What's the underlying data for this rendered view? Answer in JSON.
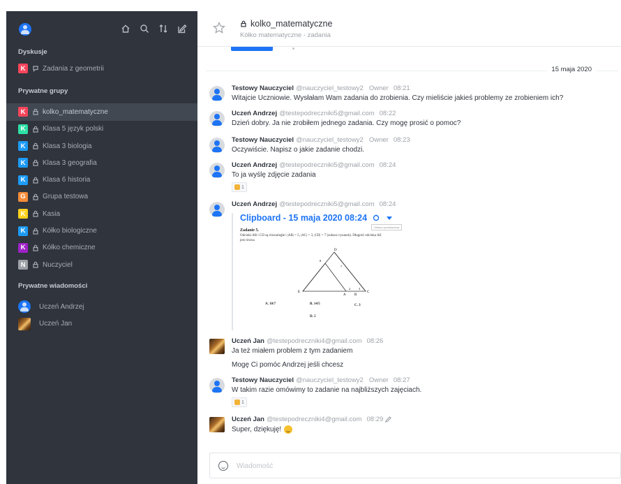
{
  "sidebar": {
    "sections": {
      "discussions": "Dyskusje",
      "private_groups": "Prywatne grupy",
      "private_messages": "Prywatne wiadomości"
    },
    "discussions": [
      {
        "badge": "K",
        "color": "#f5455c",
        "label": "Zadania z geometrii"
      }
    ],
    "groups": [
      {
        "badge": "K",
        "color": "#f5455c",
        "label": "kolko_matematyczne",
        "active": true
      },
      {
        "badge": "K",
        "color": "#2de0a5",
        "label": "Klasa 5 język polski"
      },
      {
        "badge": "K",
        "color": "#1d9bf5",
        "label": "Klasa 3 biologia"
      },
      {
        "badge": "K",
        "color": "#1d9bf5",
        "label": "Klasa 3 geografia"
      },
      {
        "badge": "K",
        "color": "#1d9bf5",
        "label": "Klasa 6 historia"
      },
      {
        "badge": "G",
        "color": "#f38c39",
        "label": "Grupa testowa"
      },
      {
        "badge": "K",
        "color": "#ffd21f",
        "label": "Kasia"
      },
      {
        "badge": "K",
        "color": "#1d9bf5",
        "label": "Kółko biologiczne"
      },
      {
        "badge": "K",
        "color": "#9f22c7",
        "label": "Kółko chemiczne"
      },
      {
        "badge": "N",
        "color": "#9ea2a8",
        "label": "Nuczyciel"
      }
    ],
    "direct_messages": [
      {
        "label": "Uczeń Andrzej",
        "avatar": "user-icon"
      },
      {
        "label": "Uczeń Jan",
        "avatar": "photo"
      }
    ]
  },
  "header": {
    "title": "kolko_matematyczne",
    "subtitle": "Kółko matematyczne - zadania"
  },
  "date_separator": "15 maja 2020",
  "messages": [
    {
      "name": "Testowy Nauczyciel",
      "user": "@nauczyciel_testowy2",
      "role": "Owner",
      "time": "08:21",
      "text": "Witajcie Uczniowie. Wysłałam Wam zadania do zrobienia. Czy mieliście jakieś problemy ze zrobieniem ich?"
    },
    {
      "name": "Uczeń Andrzej",
      "user": "@testepodreczniki5@gmail.com",
      "time": "08:22",
      "text": "Dzień dobry. Ja nie zrobiłem jednego zadania. Czy mogę prosić o pomoc?"
    },
    {
      "name": "Testowy Nauczyciel",
      "user": "@nauczyciel_testowy2",
      "role": "Owner",
      "time": "08:23",
      "text": "Oczywiście. Napisz o jakie zadanie chodzi."
    },
    {
      "name": "Uczeń Andrzej",
      "user": "@testepodreczniki5@gmail.com",
      "time": "08:24",
      "text": "To ja wyślę zdjęcie zadania",
      "reaction_count": "1"
    },
    {
      "name": "Uczeń Andrzej",
      "user": "@testepodreczniki5@gmail.com",
      "time": "08:24",
      "attachment_title": "Clipboard - 15 maja 2020 08:24"
    },
    {
      "name": "Uczeń Jan",
      "user": "@testepodreczniki4@gmail.com",
      "time": "08:26",
      "text": "Ja też miałem problem z tym zadaniem",
      "text2": "Mogę Ci pomóc Andrzej jeśli chcesz"
    },
    {
      "name": "Testowy Nauczyciel",
      "user": "@nauczyciel_testowy2",
      "role": "Owner",
      "time": "08:27",
      "text": "W takim razie omówimy to zadanie na najbliższych zajęciach.",
      "reaction_count": "1"
    },
    {
      "name": "Uczeń Jan",
      "user": "@testepodreczniki4@gmail.com",
      "time": "08:29",
      "text": "Super, dziękuję!"
    }
  ],
  "attachment_doc": {
    "title": "Zadanie 5.",
    "line1": "Odcinki AB i CD są równoległe i |AB| = 5, |AC| = 3, |CD| = 7 (zobacz rysunek). Długość odcinka AE",
    "line2": "jest równa",
    "stamp": "Matura podstawowa",
    "answers": {
      "a": "A. 10/7",
      "b": "B. 14/5",
      "c": "C. 3",
      "d": "D. 5"
    },
    "points": {
      "A": "A",
      "B": "B",
      "C": "C",
      "D": "D",
      "E": "E"
    },
    "seg_labels": {
      "s1": "8",
      "s2": "7",
      "s3": "3",
      "s4": "2"
    }
  },
  "composer": {
    "placeholder": "Wiadomość"
  }
}
